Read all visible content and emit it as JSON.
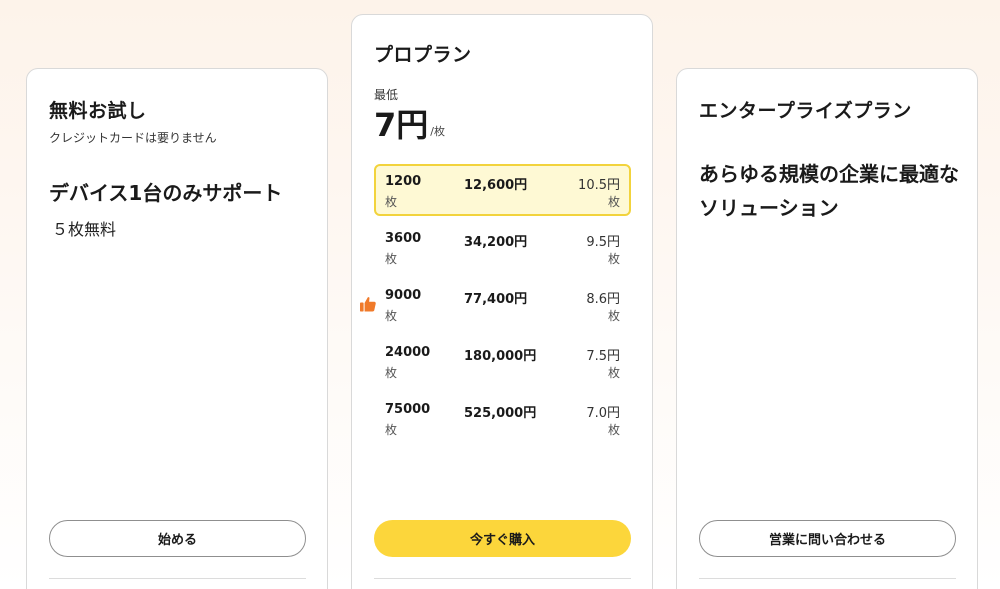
{
  "free": {
    "title": "無料お試し",
    "subtitle": "クレジットカードは要りません",
    "headline": "デバイス1台のみサポート",
    "count": "５枚無料",
    "button": "始める"
  },
  "pro": {
    "title": "プロプラン",
    "min_label": "最低",
    "price": "7円",
    "price_unit": "/枚",
    "tiers": [
      {
        "qty": "1200",
        "unit": "枚",
        "total": "12,600円",
        "per": "10.5円",
        "per_unit": "枚",
        "selected": true
      },
      {
        "qty": "3600",
        "unit": "枚",
        "total": "34,200円",
        "per": "9.5円",
        "per_unit": "枚",
        "selected": false
      },
      {
        "qty": "9000",
        "unit": "枚",
        "total": "77,400円",
        "per": "8.6円",
        "per_unit": "枚",
        "selected": false
      },
      {
        "qty": "24000",
        "unit": "枚",
        "total": "180,000円",
        "per": "7.5円",
        "per_unit": "枚",
        "selected": false
      },
      {
        "qty": "75000",
        "unit": "枚",
        "total": "525,000円",
        "per": "7.0円",
        "per_unit": "枚",
        "selected": false
      }
    ],
    "recommended_icon": "thumbs-up-icon",
    "button": "今すぐ購入"
  },
  "enterprise": {
    "title": "エンタープライズプラン",
    "headline": "あらゆる規模の企業に最適なソリューション",
    "button": "営業に問い合わせる"
  },
  "colors": {
    "accent": "#fcd63b",
    "selected_bg": "#fef9d4",
    "selected_border": "#f2d33c",
    "thumb": "#f07a2a"
  }
}
